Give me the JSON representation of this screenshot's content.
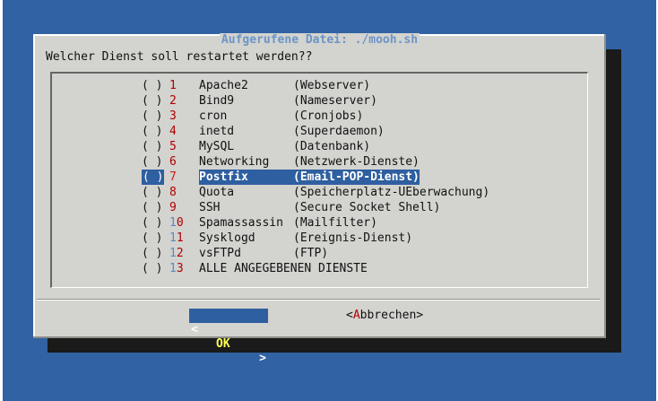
{
  "dialog": {
    "title": "Aufgerufene Datei: ./mooh.sh",
    "prompt": "Welcher Dienst soll restartet werden??"
  },
  "items": [
    {
      "mark": "( )",
      "num": "1",
      "service": "Apache2",
      "desc": "(Webserver)"
    },
    {
      "mark": "( )",
      "num": "2",
      "service": "Bind9",
      "desc": "(Nameserver)"
    },
    {
      "mark": "( )",
      "num": "3",
      "service": "cron",
      "desc": "(Cronjobs)"
    },
    {
      "mark": "( )",
      "num": "4",
      "service": "inetd",
      "desc": "(Superdaemon)"
    },
    {
      "mark": "( )",
      "num": "5",
      "service": "MySQL",
      "desc": "(Datenbank)"
    },
    {
      "mark": "( )",
      "num": "6",
      "service": "Networking",
      "desc": "(Netzwerk-Dienste)"
    },
    {
      "mark": "( )",
      "num": "7",
      "service": "Postfix",
      "desc": "(Email-POP-Dienst)"
    },
    {
      "mark": "( )",
      "num": "8",
      "service": "Quota",
      "desc": "(Speicherplatz-UEberwachung)"
    },
    {
      "mark": "( )",
      "num": "9",
      "service": "SSH",
      "desc": "(Secure Socket Shell)"
    },
    {
      "mark": "( )",
      "num": "10",
      "service": "Spamassassin",
      "desc": "(Mailfilter)"
    },
    {
      "mark": "( )",
      "num": "11",
      "service": "Sysklogd",
      "desc": "(Ereignis-Dienst)"
    },
    {
      "mark": "( )",
      "num": "12",
      "service": "vsFTPd",
      "desc": "(FTP)"
    },
    {
      "mark": "( )",
      "num": "13",
      "service": "ALLE ANGEGEBENEN DIENSTE",
      "desc": ""
    }
  ],
  "selected_index": 6,
  "buttons": {
    "ok": {
      "left": "<",
      "label": "OK",
      "right": ">"
    },
    "cancel": {
      "open": "<",
      "hotkey": "A",
      "rest": "bbrechen",
      "close": ">"
    }
  },
  "colors": {
    "desktop": "#3162a3",
    "dialog": "#d3d3cf",
    "highlight": "#2e5fa0",
    "hotkey": "#b00000",
    "title": "#6b95c7"
  }
}
